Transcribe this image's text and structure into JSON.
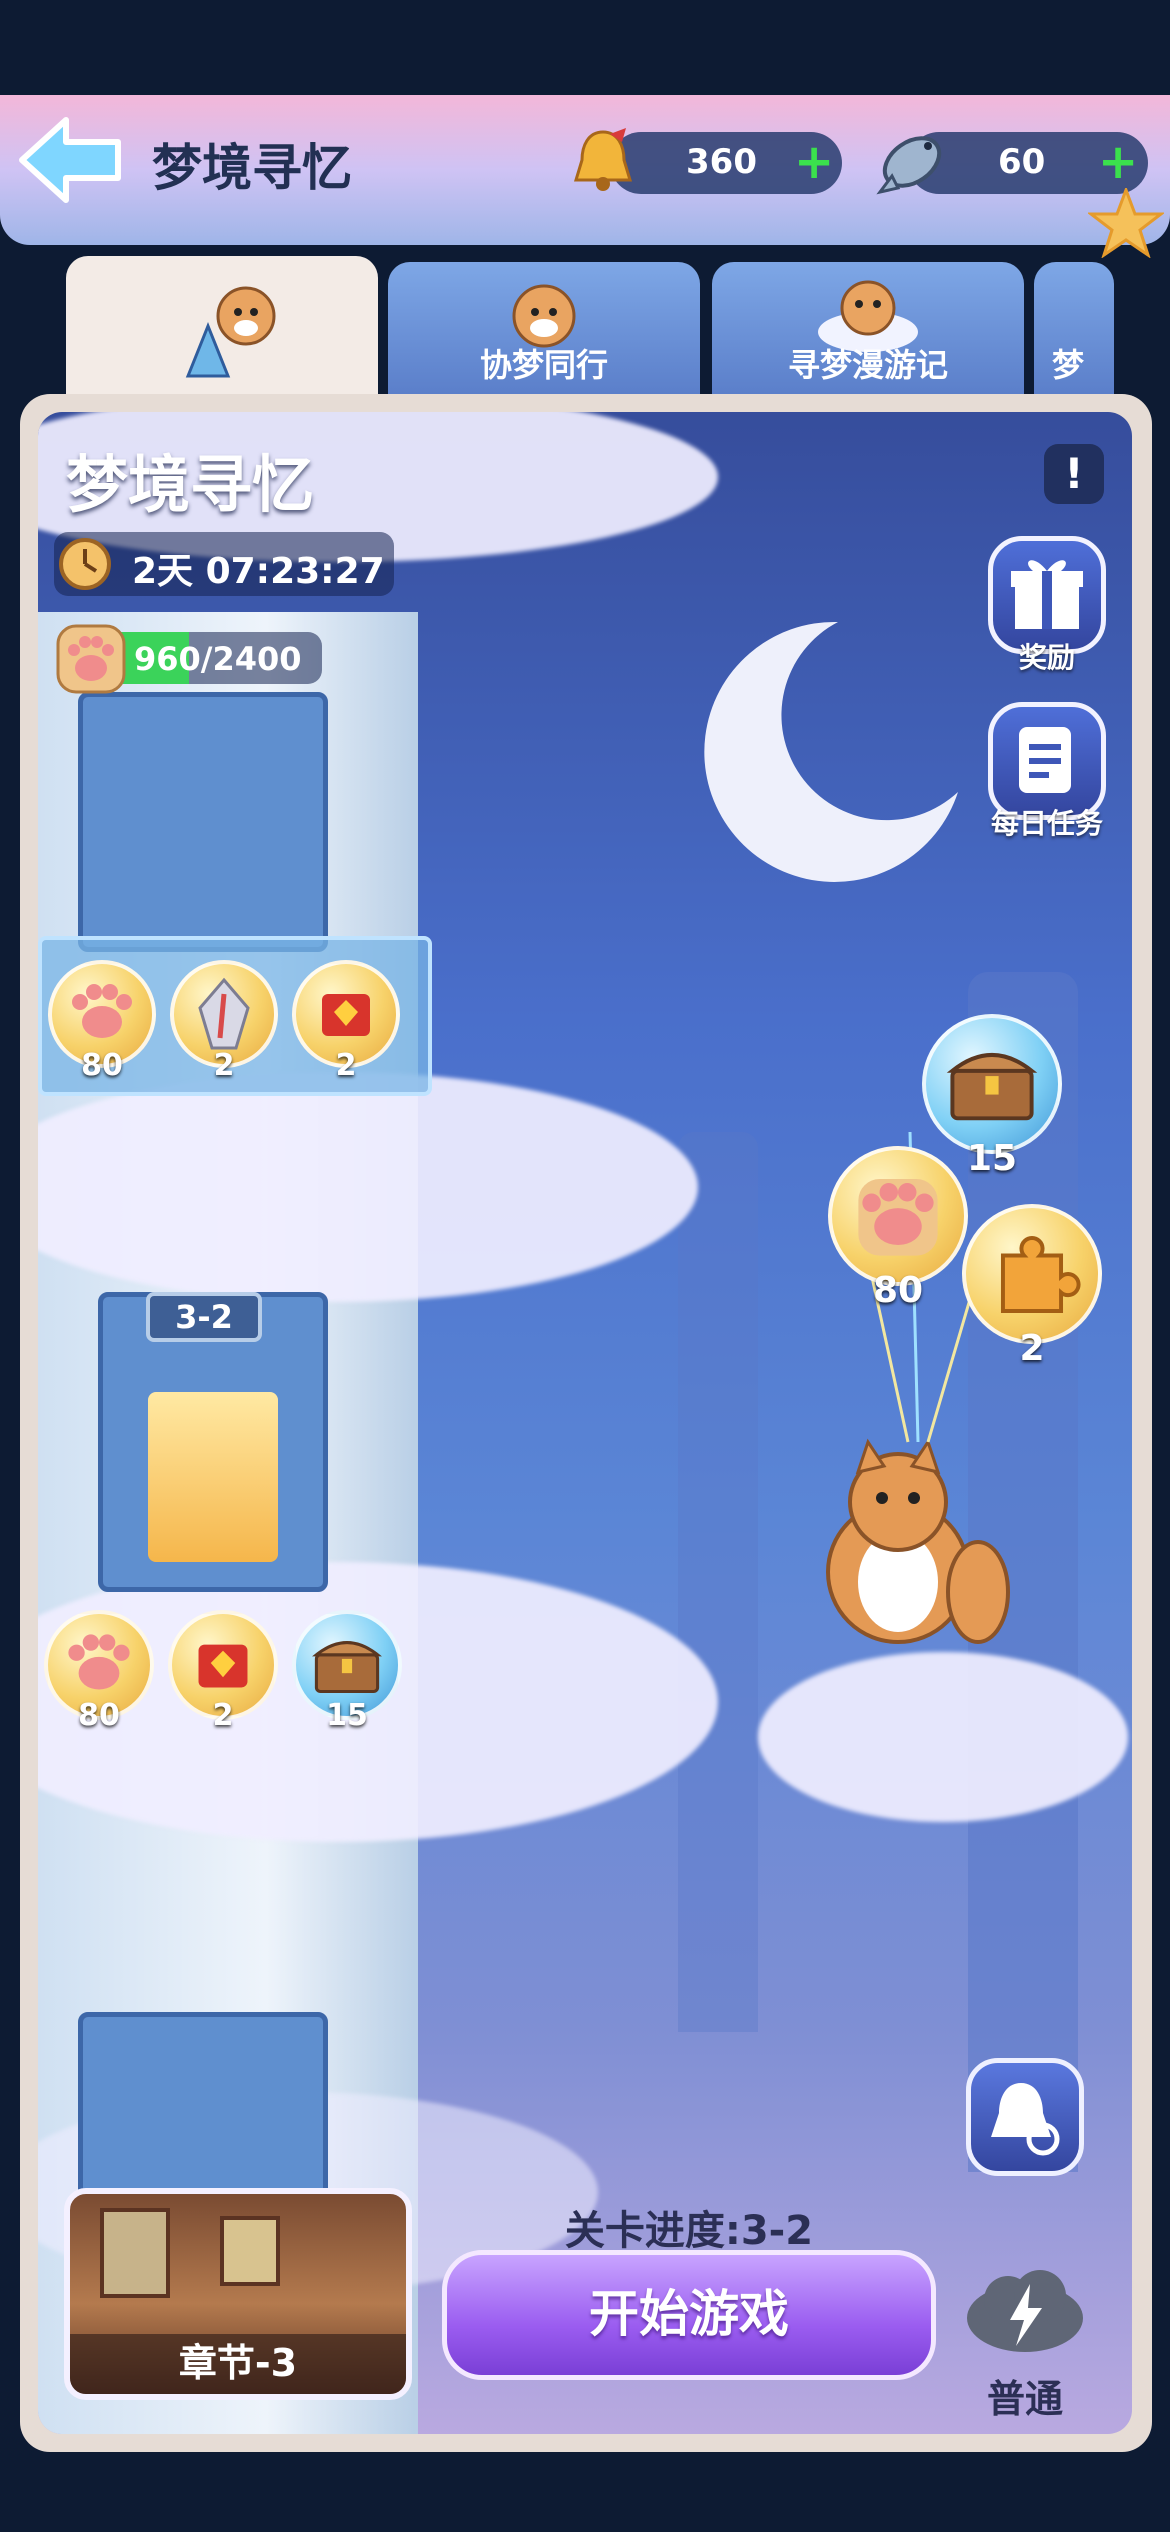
{
  "header": {
    "title": "梦境寻忆",
    "bell_currency": "360",
    "fish_currency": "60"
  },
  "tabs": [
    {
      "label": ""
    },
    {
      "label": "协梦同行"
    },
    {
      "label": "寻梦漫游记"
    },
    {
      "label": "梦"
    }
  ],
  "event": {
    "title": "梦境寻忆",
    "timer": "2天 07:23:27",
    "progress_text": "960/2400",
    "progress_fraction": 0.4
  },
  "side_buttons": {
    "rewards_label": "奖励",
    "daily_tasks_label": "每日任务"
  },
  "upper_rewards": [
    "80",
    "2",
    "2"
  ],
  "level_badge": "3-2",
  "lower_rewards": [
    "80",
    "2",
    "15"
  ],
  "balloon_rewards": [
    "15",
    "80",
    "2"
  ],
  "bottom": {
    "progress_label": "关卡进度:3-2",
    "start_button": "开始游戏",
    "chapter_label": "章节-3",
    "difficulty_label": "普通"
  }
}
